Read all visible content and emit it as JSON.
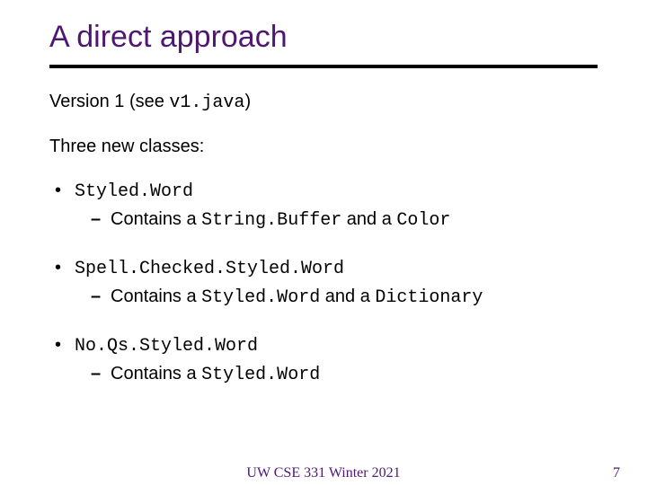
{
  "title": "A direct approach",
  "intro": {
    "prefix": "Version 1 (see ",
    "code": "v1.java",
    "suffix": ")"
  },
  "subheading": "Three new classes:",
  "bullets": [
    {
      "name": "Styled.Word",
      "sub_prefix": "Contains a ",
      "c1": "String.Buffer",
      "mid": " and a ",
      "c2": "Color"
    },
    {
      "name": "Spell.Checked.Styled.Word",
      "sub_prefix": "Contains a ",
      "c1": "Styled.Word",
      "mid": " and a ",
      "c2": "Dictionary"
    },
    {
      "name": "No.Qs.Styled.Word",
      "sub_prefix": "Contains a ",
      "c1": "Styled.Word"
    }
  ],
  "footer": {
    "center": "UW CSE 331 Winter 2021",
    "page": "7"
  },
  "colors": {
    "accent": "#4e1771"
  }
}
